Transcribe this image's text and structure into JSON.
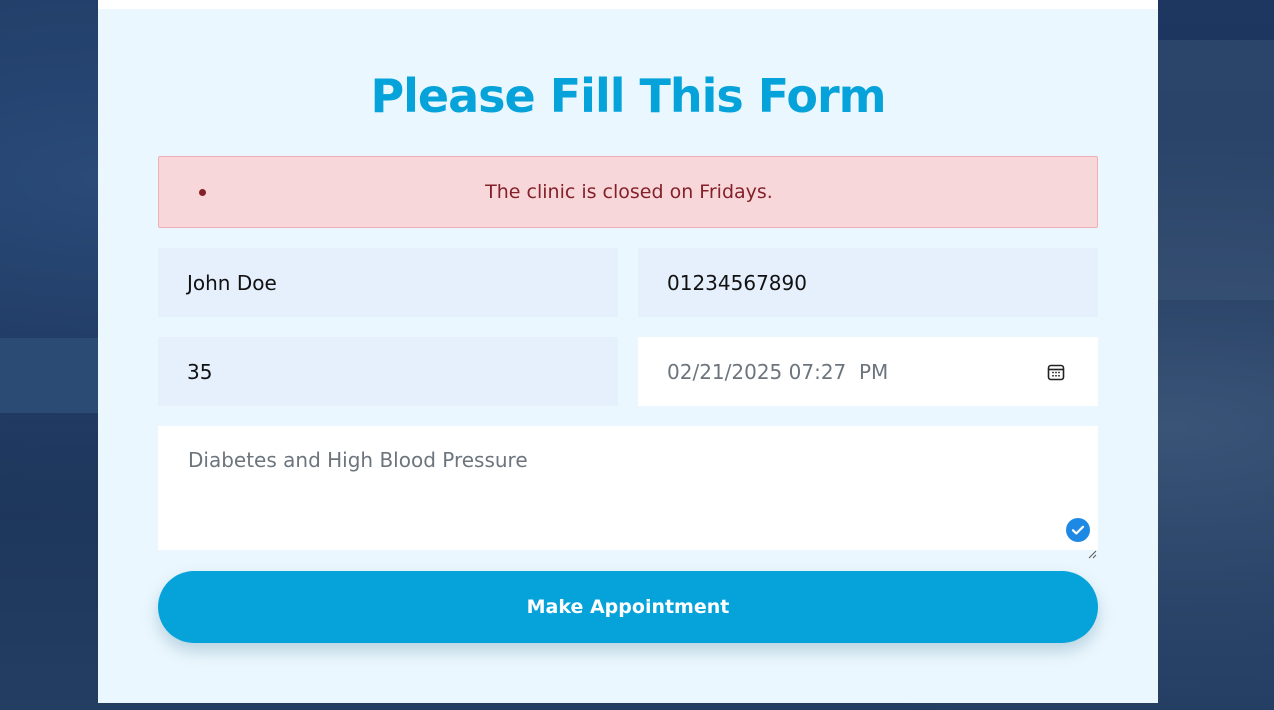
{
  "form": {
    "title": "Please Fill This Form",
    "error_message": "The clinic is closed on Fridays.",
    "name_value": "John Doe",
    "phone_value": "01234567890",
    "age_value": "35",
    "datetime_value": "02/21/2025 07:27  PM",
    "notes_value": "Diabetes and High Blood Pressure",
    "submit_label": "Make Appointment"
  },
  "icons": {
    "calendar": "calendar-icon",
    "check": "checkmark-icon",
    "resize": "resize-grip-icon"
  },
  "colors": {
    "accent": "#06a3da",
    "error_text": "#842029",
    "error_bg": "#f8d7da",
    "card_bg": "#ebf7fe",
    "input_bg": "#e6effc"
  }
}
